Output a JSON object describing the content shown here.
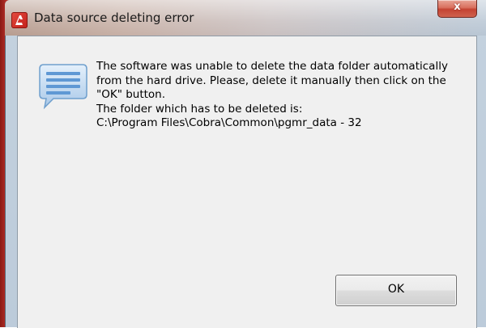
{
  "window": {
    "title": "Data source deleting error",
    "close_label": "x"
  },
  "dialog": {
    "message_lines": [
      "The software was unable to delete the data folder automatically",
      "from the hard drive. Please, delete it manually then click on the",
      "\"OK\" button.",
      "The folder which has to be deleted is:",
      "C:\\Program Files\\Cobra\\Common\\pgmr_data - 32"
    ],
    "icon": "info-speech-bubble-icon",
    "ok_label": "OK"
  },
  "colors": {
    "close_button": "#c44332",
    "client_background": "#f0f0f0",
    "app_icon": "#d63a30"
  }
}
